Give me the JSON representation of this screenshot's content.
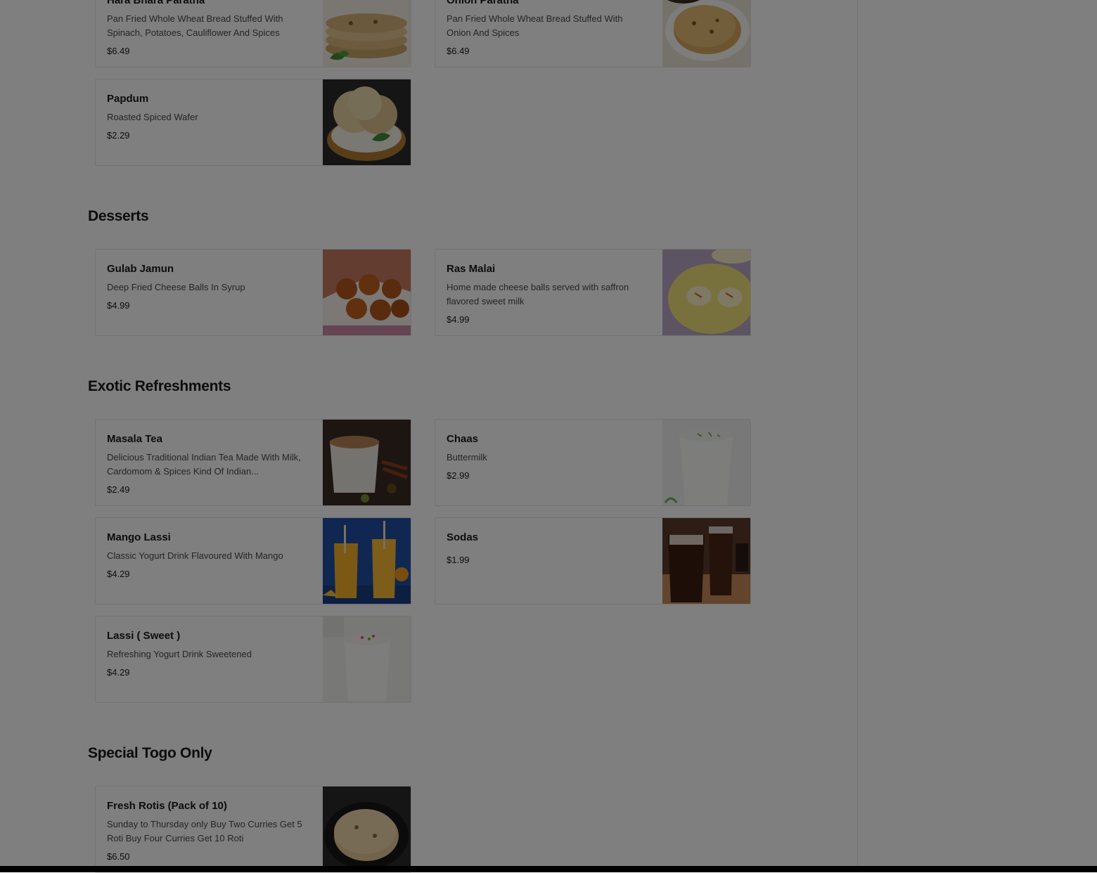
{
  "sections": [
    {
      "items": [
        {
          "name": "Hara Bhara Paratha",
          "desc": "Pan Fried Whole Wheat Bread Stuffed With Spinach, Potatoes, Cauliflower And Spices",
          "price": "$6.49",
          "image": "paratha-stack-photo"
        },
        {
          "name": "Onion Paratha",
          "desc": "Pan Fried Whole Wheat Bread Stuffed With Onion And Spices",
          "price": "$6.49",
          "image": "paratha-plate-photo"
        },
        {
          "name": "Papdum",
          "desc": "Roasted Spiced Wafer",
          "price": "$2.29",
          "image": "papad-basket-photo"
        }
      ]
    },
    {
      "title": "Desserts",
      "items": [
        {
          "name": "Gulab Jamun",
          "desc": "Deep Fried Cheese Balls In Syrup",
          "price": "$4.99",
          "image": "gulab-jamun-photo"
        },
        {
          "name": "Ras Malai",
          "desc": "Home made cheese balls served with saffron flavored sweet milk",
          "price": "$4.99",
          "image": "ras-malai-photo"
        }
      ]
    },
    {
      "title": "Exotic Refreshments",
      "items": [
        {
          "name": "Masala Tea",
          "desc": "Delicious Traditional Indian Tea Made With Milk, Cardomom & Spices Kind Of Indian...",
          "price": "$2.49",
          "image": "masala-tea-photo"
        },
        {
          "name": "Chaas",
          "desc": "Buttermilk",
          "price": "$2.99",
          "image": "chaas-glass-photo"
        },
        {
          "name": "Mango Lassi",
          "desc": "Classic Yogurt Drink Flavoured With Mango",
          "price": "$4.29",
          "image": "mango-lassi-photo"
        },
        {
          "name": "Sodas",
          "desc": "",
          "price": "$1.99",
          "image": "soda-glasses-photo"
        },
        {
          "name": "Lassi ( Sweet )",
          "desc": "Refreshing Yogurt Drink Sweetened",
          "price": "$4.29",
          "image": "sweet-lassi-photo"
        }
      ]
    },
    {
      "title": "Special Togo Only",
      "items": [
        {
          "name": "Fresh Rotis (Pack of 10)",
          "desc": "Sunday to Thursday only Buy Two Curries Get 5 Roti Buy Four Curries Get 10 Roti",
          "price": "$6.50",
          "image": "roti-stack-photo"
        }
      ]
    }
  ],
  "colors": {
    "overlay": "rgba(0,0,0,0.5)",
    "text": "#191919",
    "muted": "#494949",
    "border": "#e4e4e4"
  }
}
